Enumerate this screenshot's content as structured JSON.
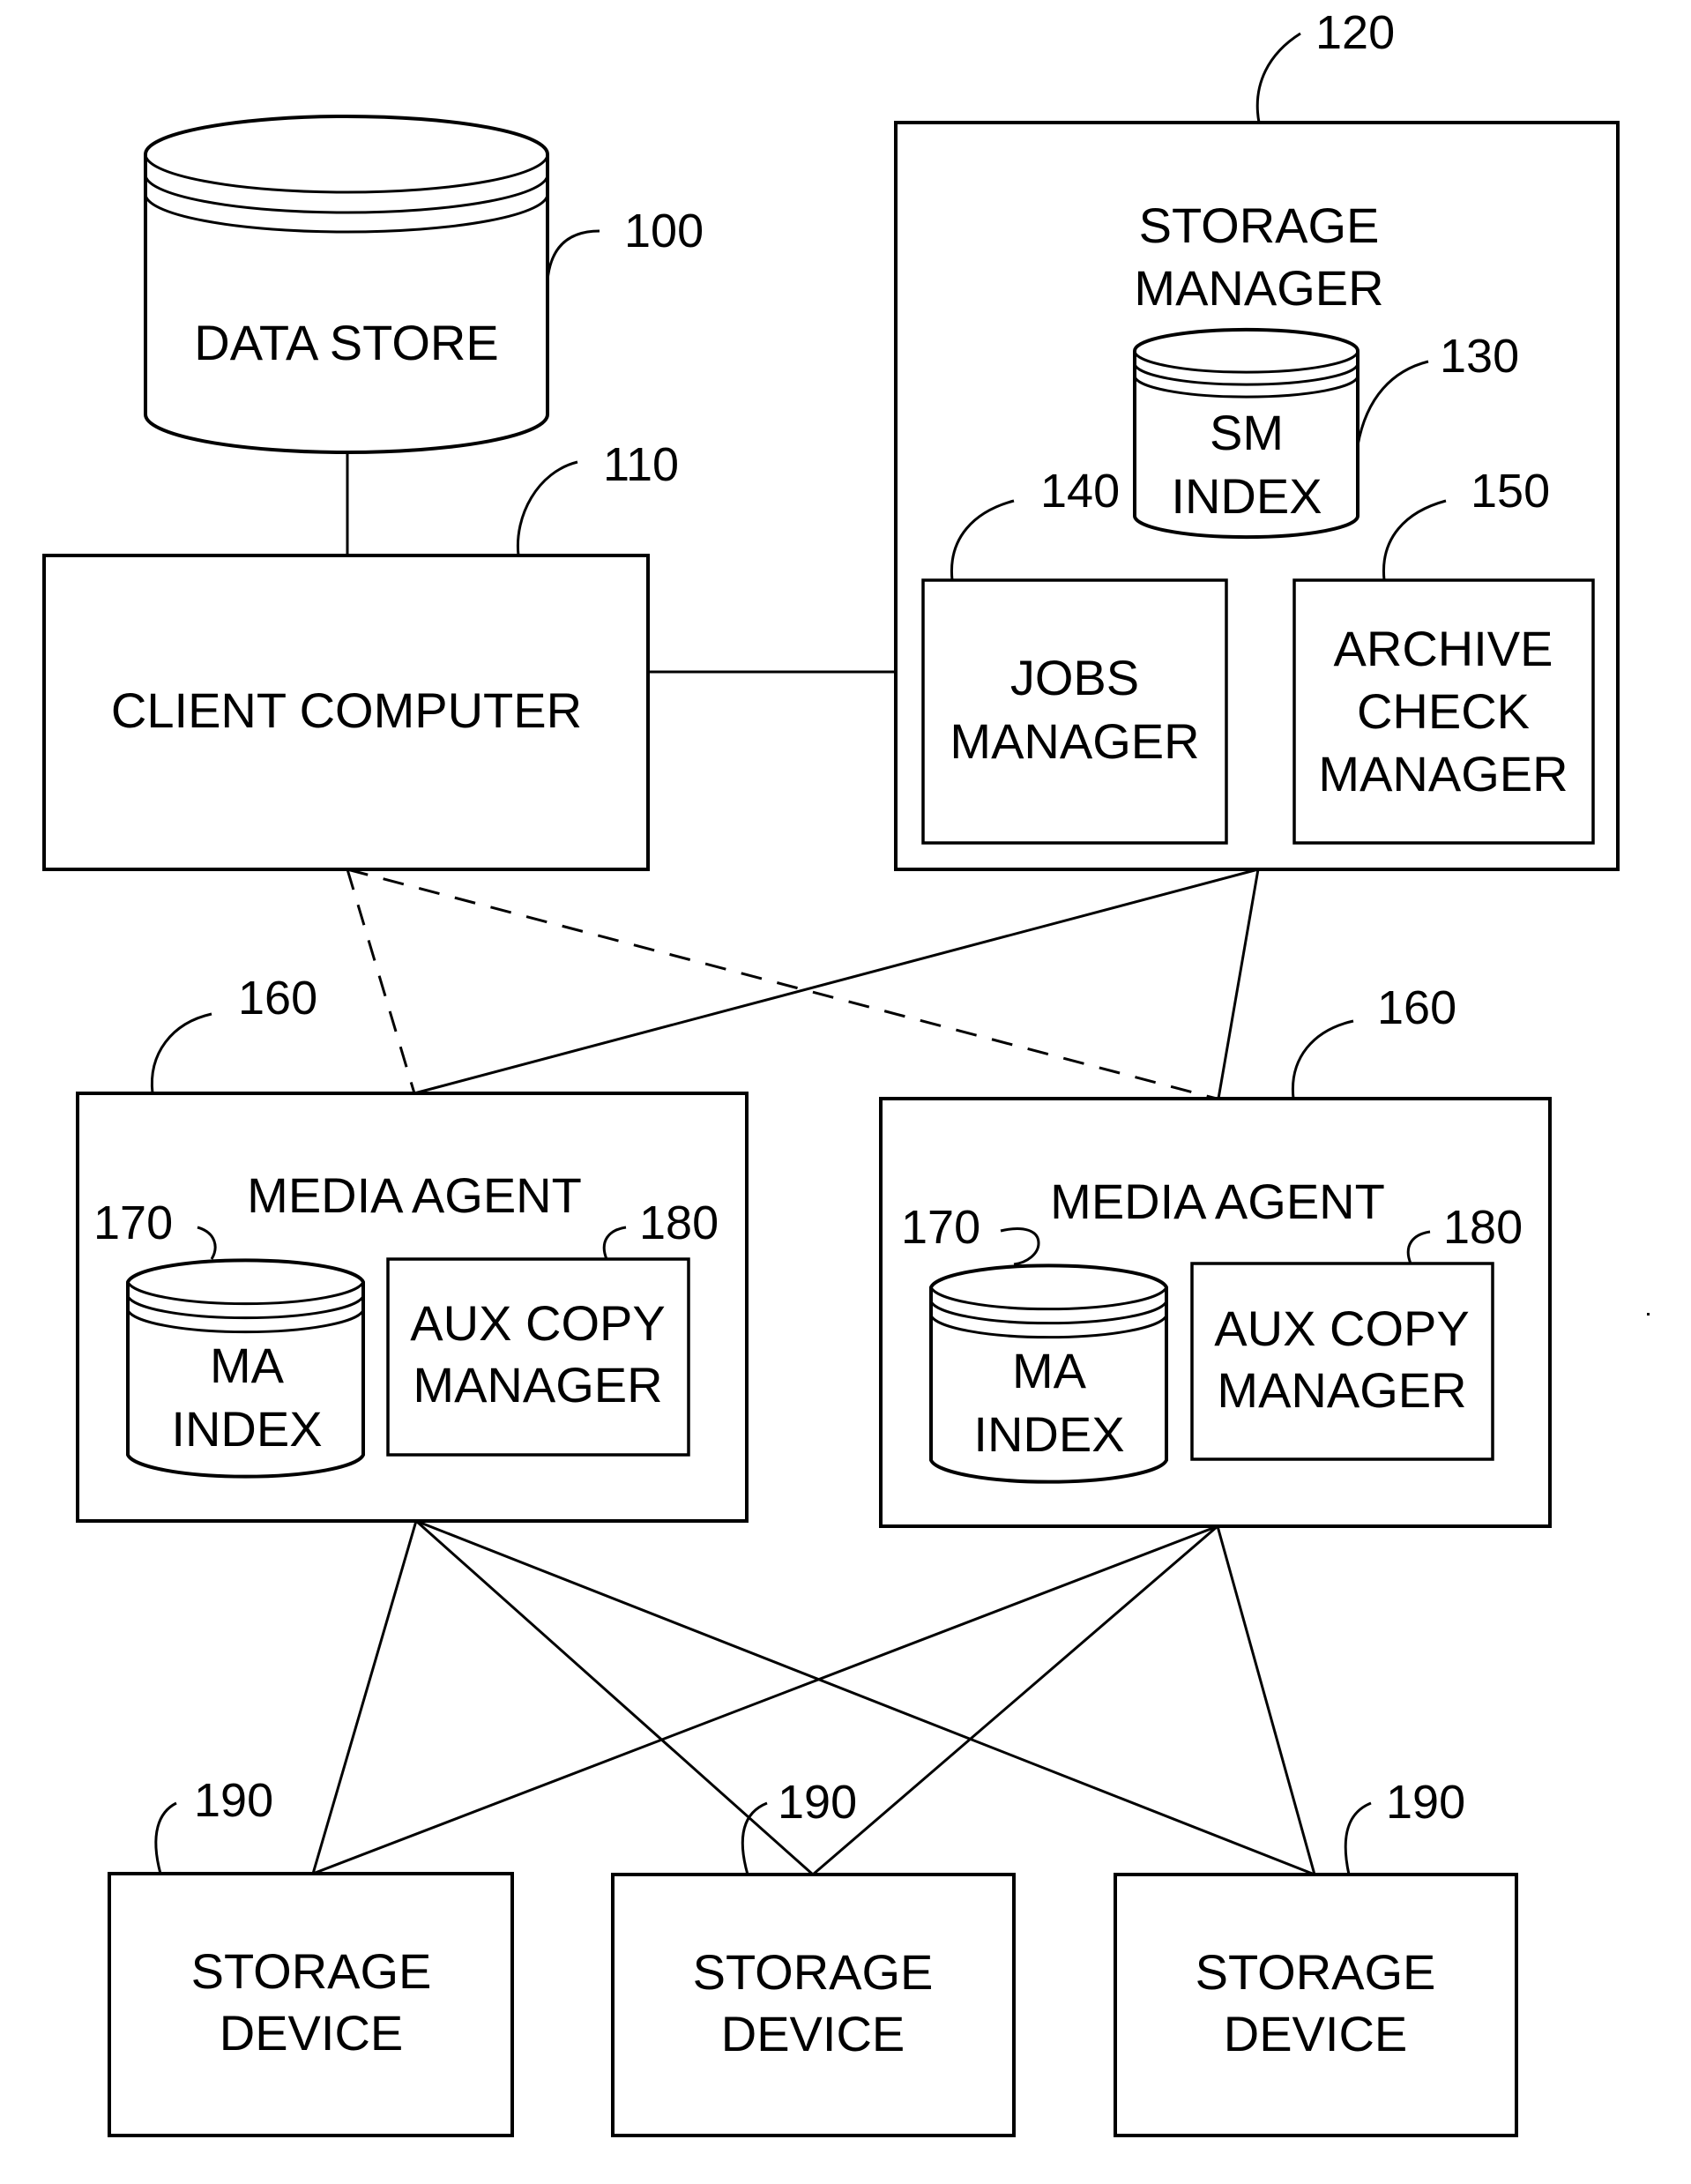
{
  "diagram": {
    "data_store": {
      "label": "DATA STORE",
      "ref": "100"
    },
    "client_computer": {
      "label": "CLIENT COMPUTER",
      "ref": "110"
    },
    "storage_manager": {
      "label_lines": [
        "STORAGE",
        "MANAGER"
      ],
      "ref": "120",
      "sm_index": {
        "label_lines": [
          "SM",
          "INDEX"
        ],
        "ref": "130"
      },
      "jobs_manager": {
        "label_lines": [
          "JOBS",
          "MANAGER"
        ],
        "ref": "140"
      },
      "archive_check_manager": {
        "label_lines": [
          "ARCHIVE",
          "CHECK",
          "MANAGER"
        ],
        "ref": "150"
      }
    },
    "media_agents": [
      {
        "label": "MEDIA AGENT",
        "ref": "160",
        "ma_index": {
          "label_lines": [
            "MA",
            "INDEX"
          ],
          "ref": "170"
        },
        "aux_copy_manager": {
          "label_lines": [
            "AUX COPY",
            "MANAGER"
          ],
          "ref": "180"
        }
      },
      {
        "label": "MEDIA AGENT",
        "ref": "160",
        "ma_index": {
          "label_lines": [
            "MA",
            "INDEX"
          ],
          "ref": "170"
        },
        "aux_copy_manager": {
          "label_lines": [
            "AUX COPY",
            "MANAGER"
          ],
          "ref": "180"
        }
      }
    ],
    "storage_devices": [
      {
        "label_lines": [
          "STORAGE",
          "DEVICE"
        ],
        "ref": "190"
      },
      {
        "label_lines": [
          "STORAGE",
          "DEVICE"
        ],
        "ref": "190"
      },
      {
        "label_lines": [
          "STORAGE",
          "DEVICE"
        ],
        "ref": "190"
      }
    ],
    "connections": [
      {
        "from": "data_store",
        "to": "client_computer",
        "style": "solid"
      },
      {
        "from": "client_computer",
        "to": "storage_manager",
        "style": "solid"
      },
      {
        "from": "client_computer",
        "to": "media_agent_1",
        "style": "dashed"
      },
      {
        "from": "client_computer",
        "to": "media_agent_2",
        "style": "dashed"
      },
      {
        "from": "storage_manager",
        "to": "media_agent_1",
        "style": "solid"
      },
      {
        "from": "storage_manager",
        "to": "media_agent_2",
        "style": "solid"
      },
      {
        "from": "media_agent_1",
        "to": "storage_device_1",
        "style": "solid"
      },
      {
        "from": "media_agent_1",
        "to": "storage_device_2",
        "style": "solid"
      },
      {
        "from": "media_agent_1",
        "to": "storage_device_3",
        "style": "solid"
      },
      {
        "from": "media_agent_2",
        "to": "storage_device_1",
        "style": "solid"
      },
      {
        "from": "media_agent_2",
        "to": "storage_device_2",
        "style": "solid"
      },
      {
        "from": "media_agent_2",
        "to": "storage_device_3",
        "style": "solid"
      }
    ]
  }
}
